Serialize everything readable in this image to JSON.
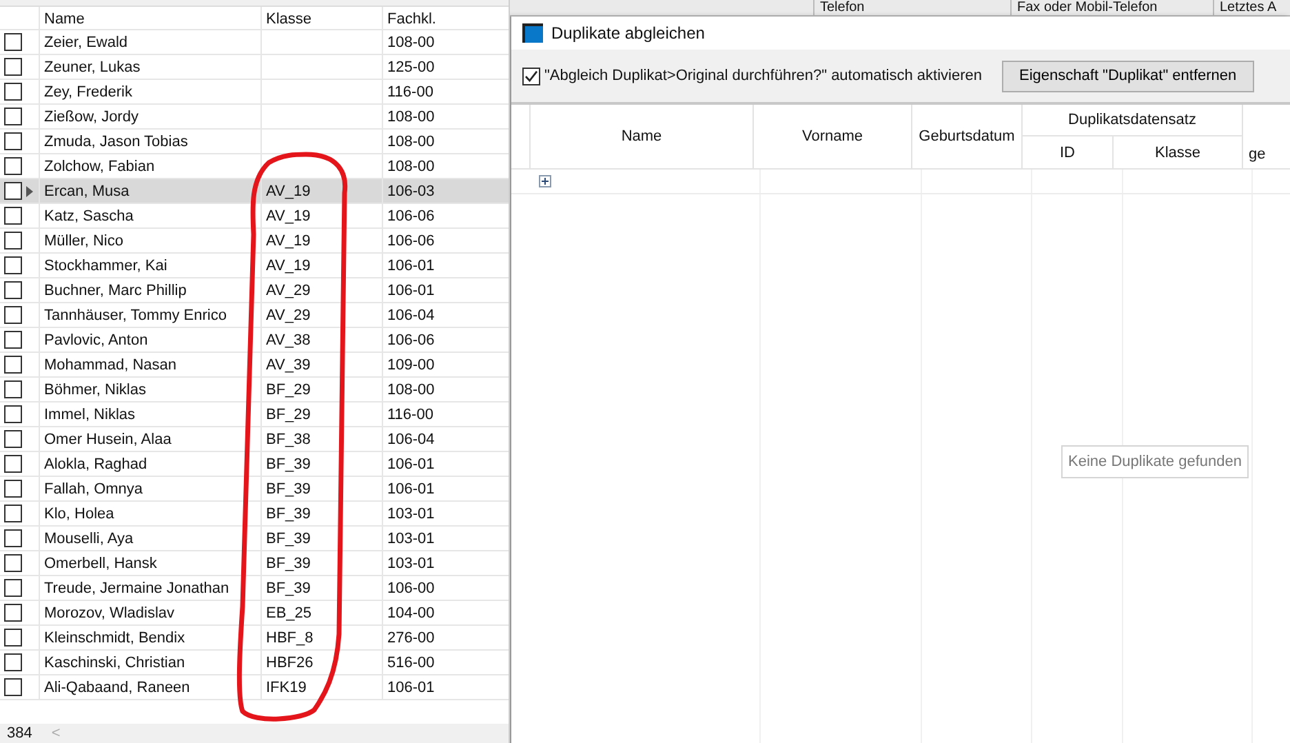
{
  "left_grid": {
    "columns": [
      "Name",
      "Klasse",
      "Fachkl."
    ],
    "rows": [
      {
        "checked": false,
        "selected": false,
        "name": "Zeier, Ewald",
        "klasse": "",
        "fachkl": "108-00"
      },
      {
        "checked": false,
        "selected": false,
        "name": "Zeuner, Lukas",
        "klasse": "",
        "fachkl": "125-00"
      },
      {
        "checked": false,
        "selected": false,
        "name": "Zey, Frederik",
        "klasse": "",
        "fachkl": "116-00"
      },
      {
        "checked": false,
        "selected": false,
        "name": "Zießow, Jordy",
        "klasse": "",
        "fachkl": "108-00"
      },
      {
        "checked": false,
        "selected": false,
        "name": "Zmuda, Jason Tobias",
        "klasse": "",
        "fachkl": "108-00"
      },
      {
        "checked": false,
        "selected": false,
        "name": "Zolchow, Fabian",
        "klasse": "",
        "fachkl": "108-00"
      },
      {
        "checked": false,
        "selected": true,
        "name": "Ercan, Musa",
        "klasse": "AV_19",
        "fachkl": "106-03"
      },
      {
        "checked": false,
        "selected": false,
        "name": "Katz, Sascha",
        "klasse": "AV_19",
        "fachkl": "106-06"
      },
      {
        "checked": false,
        "selected": false,
        "name": "Müller, Nico",
        "klasse": "AV_19",
        "fachkl": "106-06"
      },
      {
        "checked": false,
        "selected": false,
        "name": "Stockhammer, Kai",
        "klasse": "AV_19",
        "fachkl": "106-01"
      },
      {
        "checked": false,
        "selected": false,
        "name": "Buchner, Marc Phillip",
        "klasse": "AV_29",
        "fachkl": "106-01"
      },
      {
        "checked": false,
        "selected": false,
        "name": "Tannhäuser, Tommy Enrico",
        "klasse": "AV_29",
        "fachkl": "106-04"
      },
      {
        "checked": false,
        "selected": false,
        "name": "Pavlovic, Anton",
        "klasse": "AV_38",
        "fachkl": "106-06"
      },
      {
        "checked": false,
        "selected": false,
        "name": "Mohammad, Nasan",
        "klasse": "AV_39",
        "fachkl": "109-00"
      },
      {
        "checked": false,
        "selected": false,
        "name": "Böhmer, Niklas",
        "klasse": "BF_29",
        "fachkl": "108-00"
      },
      {
        "checked": false,
        "selected": false,
        "name": "Immel, Niklas",
        "klasse": "BF_29",
        "fachkl": "116-00"
      },
      {
        "checked": false,
        "selected": false,
        "name": "Omer Husein, Alaa",
        "klasse": "BF_38",
        "fachkl": "106-04"
      },
      {
        "checked": false,
        "selected": false,
        "name": "Alokla, Raghad",
        "klasse": "BF_39",
        "fachkl": "106-01"
      },
      {
        "checked": false,
        "selected": false,
        "name": "Fallah, Omnya",
        "klasse": "BF_39",
        "fachkl": "106-01"
      },
      {
        "checked": false,
        "selected": false,
        "name": "Klo, Holea",
        "klasse": "BF_39",
        "fachkl": "103-01"
      },
      {
        "checked": false,
        "selected": false,
        "name": "Mouselli, Aya",
        "klasse": "BF_39",
        "fachkl": "103-01"
      },
      {
        "checked": false,
        "selected": false,
        "name": "Omerbell, Hansk",
        "klasse": "BF_39",
        "fachkl": "103-01"
      },
      {
        "checked": false,
        "selected": false,
        "name": "Treude, Jermaine Jonathan",
        "klasse": "BF_39",
        "fachkl": "106-00"
      },
      {
        "checked": false,
        "selected": false,
        "name": "Morozov, Wladislav",
        "klasse": "EB_25",
        "fachkl": "104-00"
      },
      {
        "checked": false,
        "selected": false,
        "name": "Kleinschmidt, Bendix",
        "klasse": "HBF_8",
        "fachkl": "276-00"
      },
      {
        "checked": false,
        "selected": false,
        "name": "Kaschinski, Christian",
        "klasse": "HBF26",
        "fachkl": "516-00"
      },
      {
        "checked": false,
        "selected": false,
        "name": "Ali-Qabaand, Raneen",
        "klasse": "IFK19",
        "fachkl": "106-01"
      }
    ],
    "record_count": "384",
    "scroll_arrow": "<"
  },
  "background_header": [
    "Telefon",
    "Fax oder Mobil-Telefon",
    "Letztes A"
  ],
  "dialog": {
    "title": "Duplikate abgleichen",
    "auto_activate": {
      "label": "\"Abgleich Duplikat>Original durchführen?\" automatisch aktivieren",
      "checked": true
    },
    "remove_button": "Eigenschaft \"Duplikat\" entfernen",
    "grid": {
      "columns": [
        "Name",
        "Vorname",
        "Geburtsdatum"
      ],
      "group": {
        "label": "Duplikatsdatensatz",
        "columns": [
          "ID",
          "Klasse"
        ]
      },
      "column_7": "ge",
      "rows": [
        {
          "expanded": false
        }
      ]
    },
    "empty_message": "Keine Duplikate gefunden"
  }
}
